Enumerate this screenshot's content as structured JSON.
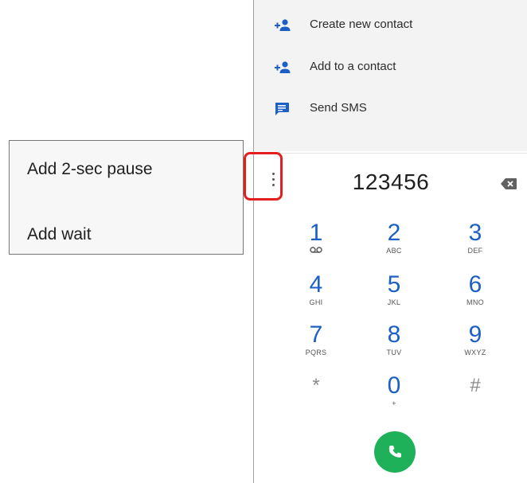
{
  "overflow_menu": {
    "items": [
      {
        "label": "Add 2-sec pause"
      },
      {
        "label": "Add wait"
      }
    ]
  },
  "actions": [
    {
      "label": "Create new contact",
      "icon": "add-person-icon"
    },
    {
      "label": "Add to a contact",
      "icon": "add-person-icon"
    },
    {
      "label": "Send SMS",
      "icon": "message-icon"
    }
  ],
  "dialed_number": "123456",
  "keypad": [
    {
      "digit": "1",
      "letters": ""
    },
    {
      "digit": "2",
      "letters": "ABC"
    },
    {
      "digit": "3",
      "letters": "DEF"
    },
    {
      "digit": "4",
      "letters": "GHI"
    },
    {
      "digit": "5",
      "letters": "JKL"
    },
    {
      "digit": "6",
      "letters": "MNO"
    },
    {
      "digit": "7",
      "letters": "PQRS"
    },
    {
      "digit": "8",
      "letters": "TUV"
    },
    {
      "digit": "9",
      "letters": "WXYZ"
    },
    {
      "digit": "*",
      "letters": ""
    },
    {
      "digit": "0",
      "letters": "+"
    },
    {
      "digit": "#",
      "letters": ""
    }
  ],
  "colors": {
    "accent": "#1c5fc5",
    "call": "#1fb05a",
    "highlight": "#e21e1e"
  }
}
